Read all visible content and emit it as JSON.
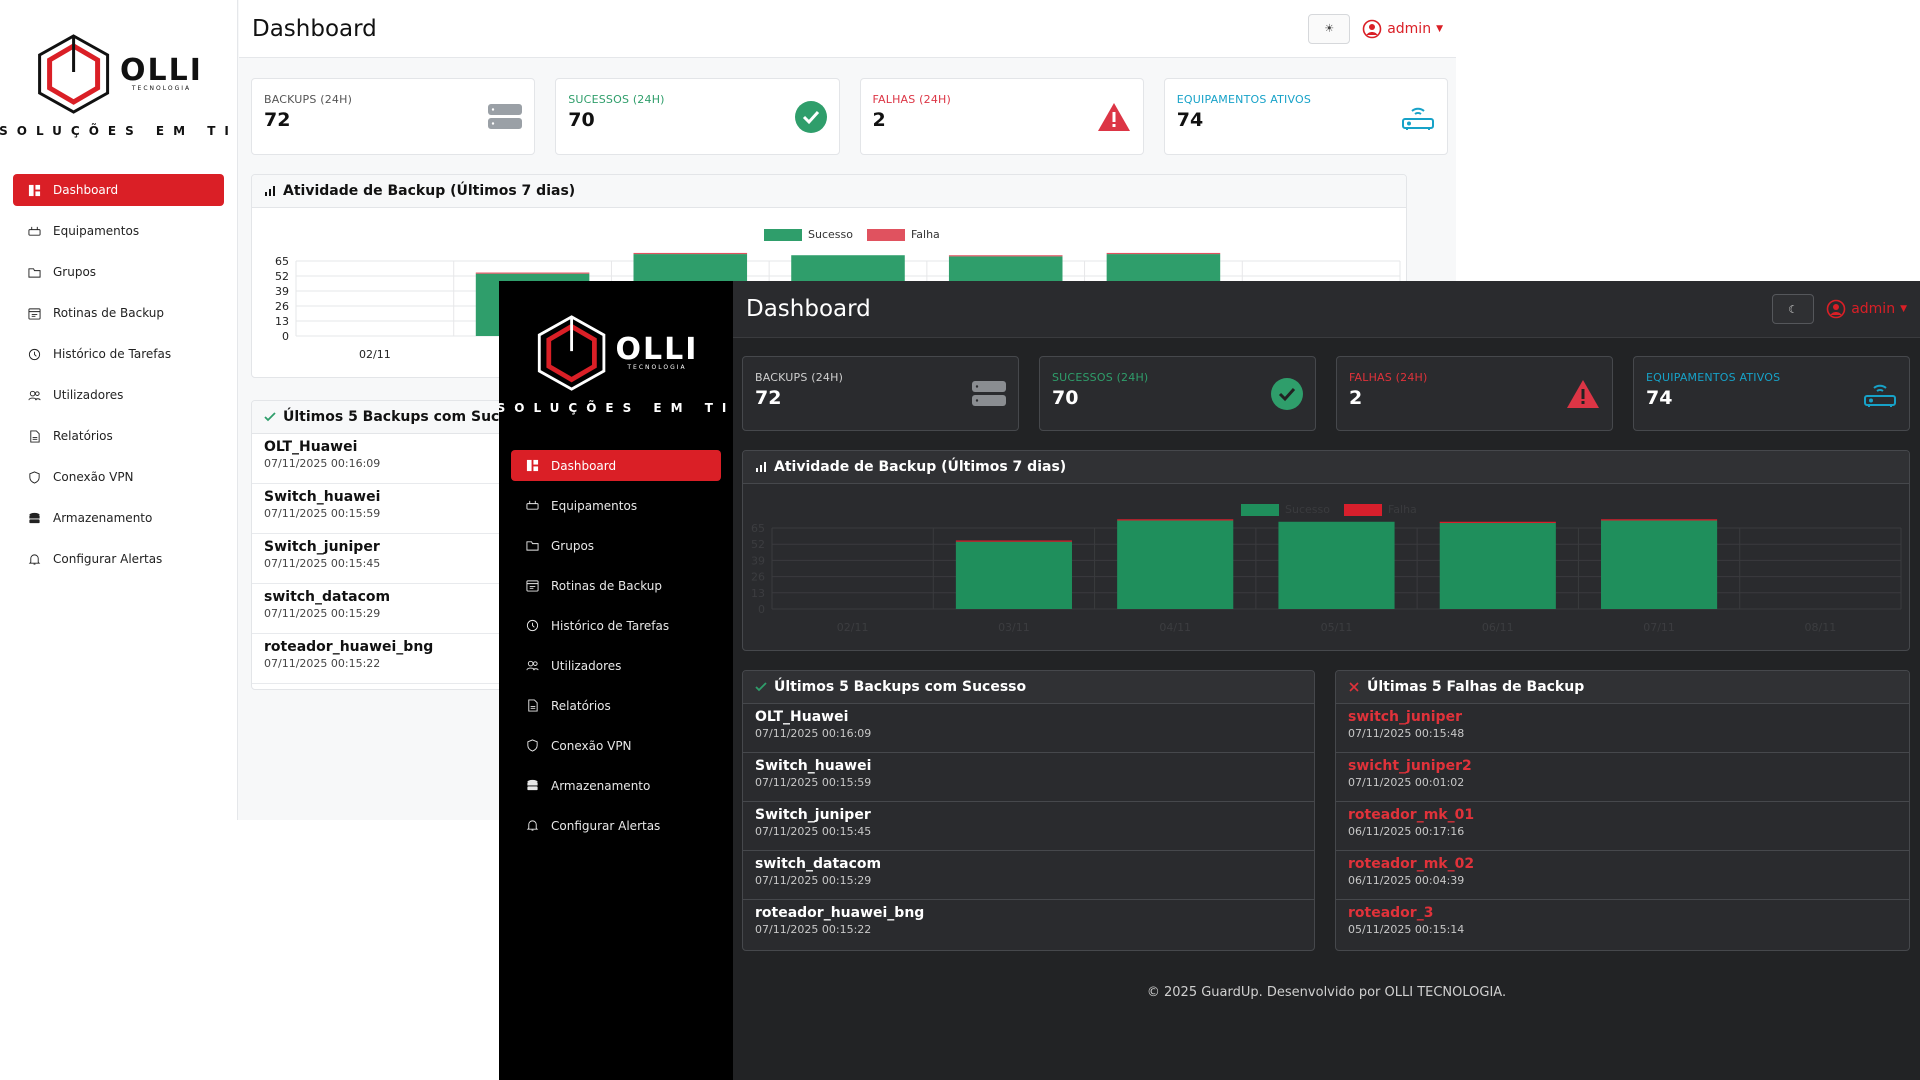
{
  "brand": {
    "name": "OLLI",
    "sub": "TECNOLOGIA",
    "tagline": "SOLUÇÕES EM TI"
  },
  "colors": {
    "accent": "#da1f26",
    "success": "#2f9e6b",
    "fail": "#dc3545",
    "info": "#17a2c8",
    "bar_green": "#1f8f5c"
  },
  "nav": [
    {
      "label": "Dashboard",
      "icon": "dashboard-icon"
    },
    {
      "label": "Equipamentos",
      "icon": "devices-icon"
    },
    {
      "label": "Grupos",
      "icon": "folder-icon"
    },
    {
      "label": "Rotinas de Backup",
      "icon": "calendar-icon"
    },
    {
      "label": "Histórico de Tarefas",
      "icon": "clock-icon"
    },
    {
      "label": "Utilizadores",
      "icon": "users-icon"
    },
    {
      "label": "Relatórios",
      "icon": "report-icon"
    },
    {
      "label": "Conexão VPN",
      "icon": "shield-icon"
    },
    {
      "label": "Armazenamento",
      "icon": "database-icon"
    },
    {
      "label": "Configurar Alertas",
      "icon": "bell-icon"
    }
  ],
  "header": {
    "title": "Dashboard",
    "user": "admin",
    "light_theme_icon": "sun-icon",
    "dark_theme_icon": "moon-icon"
  },
  "cards": [
    {
      "label": "BACKUPS (24H)",
      "value": "72",
      "icon": "server-icon"
    },
    {
      "label": "SUCESSOS (24H)",
      "value": "70",
      "icon": "check-circle-icon"
    },
    {
      "label": "FALHAS (24H)",
      "value": "2",
      "icon": "warning-icon"
    },
    {
      "label": "EQUIPAMENTOS ATIVOS",
      "value": "74",
      "icon": "router-icon"
    }
  ],
  "chart_panel": {
    "title": "Atividade de Backup (Últimos 7 dias)"
  },
  "chart_data": {
    "type": "bar",
    "categories": [
      "02/11",
      "03/11",
      "04/11",
      "05/11",
      "06/11",
      "07/11",
      "08/11"
    ],
    "series": [
      {
        "name": "Sucesso",
        "values": [
          0,
          54,
          71,
          70,
          69,
          71,
          0
        ]
      },
      {
        "name": "Falha",
        "values": [
          0,
          1,
          1,
          0,
          1,
          1,
          0
        ]
      }
    ],
    "stacked": true,
    "ylim": [
      0,
      65
    ],
    "yticks": [
      0,
      13,
      26,
      39,
      52,
      65
    ],
    "legend": "top-center"
  },
  "success_panel": {
    "title": "Últimos 5 Backups com Sucesso",
    "rows": [
      {
        "name": "OLT_Huawei",
        "date": "07/11/2025 00:16:09"
      },
      {
        "name": "Switch_huawei",
        "date": "07/11/2025 00:15:59"
      },
      {
        "name": "Switch_juniper",
        "date": "07/11/2025 00:15:45"
      },
      {
        "name": "switch_datacom",
        "date": "07/11/2025 00:15:29"
      },
      {
        "name": "roteador_huawei_bng",
        "date": "07/11/2025 00:15:22"
      }
    ]
  },
  "fail_panel": {
    "title": "Últimas 5 Falhas de Backup",
    "rows": [
      {
        "name": "switch_juniper",
        "date": "07/11/2025 00:15:48"
      },
      {
        "name": "swicht_juniper2",
        "date": "07/11/2025 00:01:02"
      },
      {
        "name": "roteador_mk_01",
        "date": "06/11/2025 00:17:16"
      },
      {
        "name": "roteador_mk_02",
        "date": "06/11/2025 00:04:39"
      },
      {
        "name": "roteador_3",
        "date": "05/11/2025 00:15:14"
      }
    ]
  },
  "footer": "© 2025 GuardUp. Desenvolvido por OLLI TECNOLOGIA."
}
